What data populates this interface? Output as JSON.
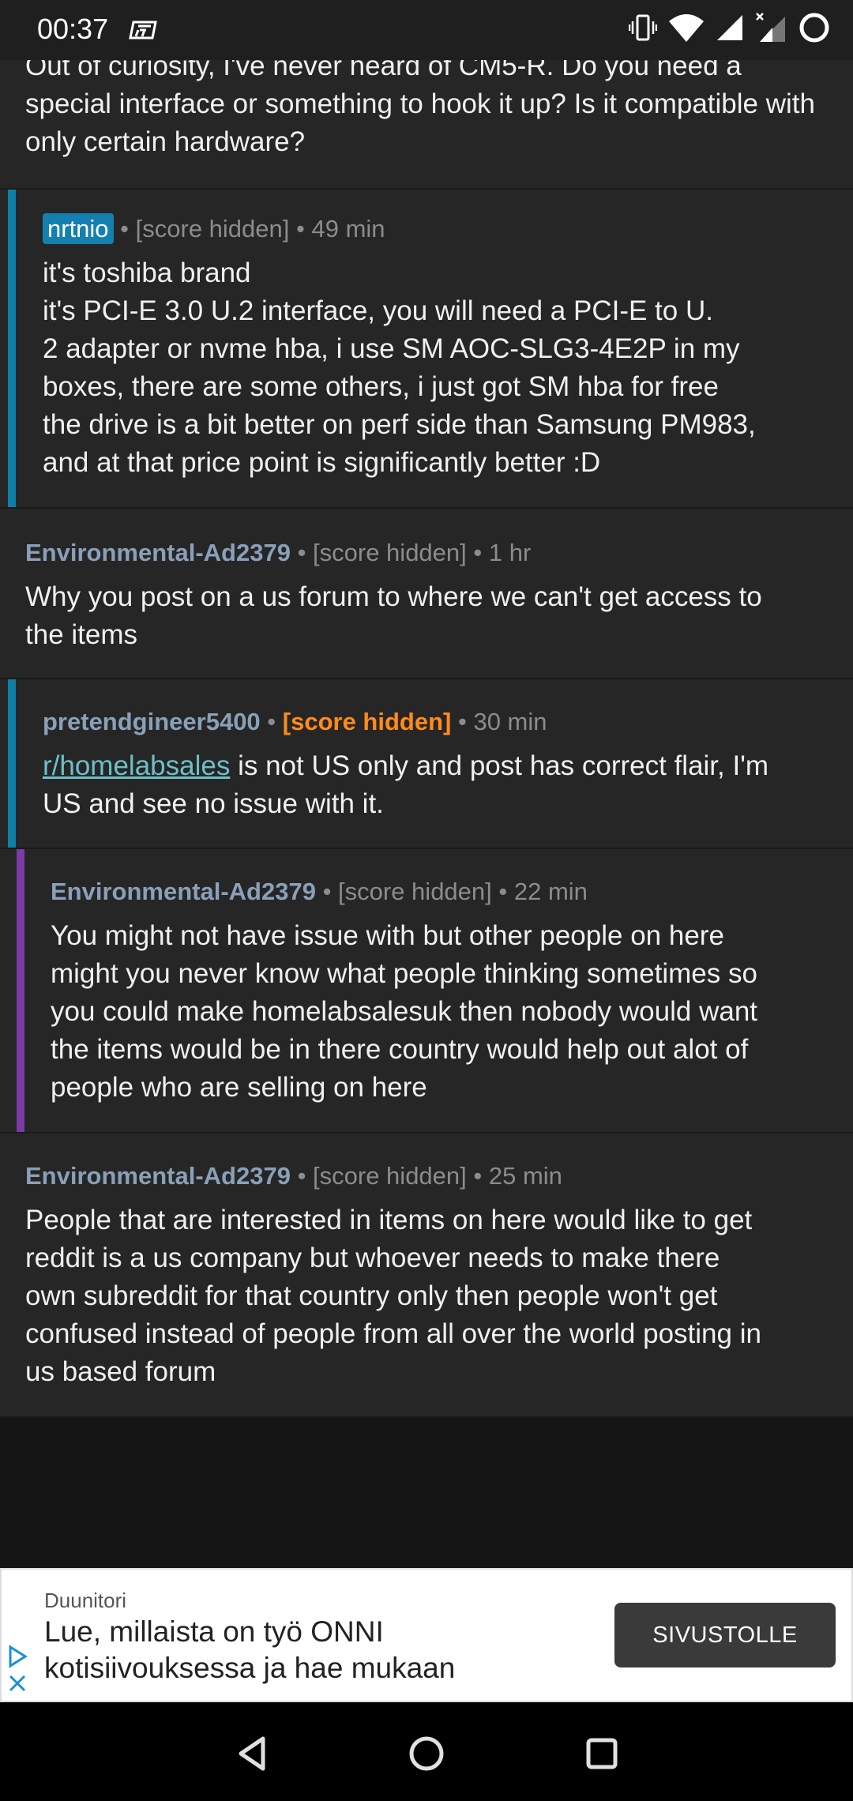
{
  "status_bar": {
    "time": "00:37"
  },
  "comments": [
    {
      "id": "c0",
      "body": "Out of curiosity, I've never heard of CM5-R. Do you need a special interface or something to hook it up? Is it compatible with only certain hardware?"
    },
    {
      "id": "c1",
      "author": "nrtnio",
      "score": "[score hidden]",
      "time": "49 min",
      "body_lines": [
        "it's toshiba brand",
        "it's PCI-E 3.0 U.2 interface, you will need a PCI-E to U.",
        "2 adapter or nvme hba, i use SM AOC-SLG3-4E2P in my",
        "boxes, there are some others, i just got SM hba for free",
        "the drive is a bit better on perf side than Samsung PM983,",
        "and at that price point is significantly better :D"
      ]
    },
    {
      "id": "c2",
      "author": "Environmental-Ad2379",
      "score": "[score hidden]",
      "time": "1 hr",
      "body_lines": [
        "Why you post on a us forum to where we can't get access to",
        "the items"
      ]
    },
    {
      "id": "c3",
      "author": "pretendgineer5400",
      "score": "[score hidden]",
      "time": "30 min",
      "link_text": "r/homelabsales",
      "body_line1_rest": " is not US only and post has correct flair, I'm",
      "body_line2": "US and see no issue with it."
    },
    {
      "id": "c4",
      "author": "Environmental-Ad2379",
      "score": "[score hidden]",
      "time": "22 min",
      "body_lines": [
        "You might not have issue with but other people on here",
        "might you never know what people thinking sometimes so",
        "you could make homelabsalesuk then nobody would want",
        "the items would be in there country would help out alot of",
        "people who are selling on here"
      ]
    },
    {
      "id": "c5",
      "author": "Environmental-Ad2379",
      "score": "[score hidden]",
      "time": "25 min",
      "body_lines": [
        "People that are interested in items on here would like to get",
        "reddit is a us company but whoever needs to make there",
        "own subreddit for that country only then people won't get",
        "confused instead of people from all over the world posting in",
        "us based forum"
      ]
    }
  ],
  "ad": {
    "advertiser": "Duunitori",
    "headline_line1": "Lue, millaista on työ ONNI",
    "headline_line2": "kotisiivouksessa ja hae mukaan",
    "cta": "SIVUSTOLLE"
  },
  "colors": {
    "bar_blue": "#0e7fa6",
    "bar_purple": "#7b3aa8",
    "flair_bg": "#1480b0",
    "score_orange": "#ff8c1a",
    "link": "#6cc0c8"
  },
  "icons": {
    "status_right": [
      "vibrate-icon",
      "wifi-icon",
      "cell-signal-icon",
      "cell-signal-noservice-icon",
      "battery-ring-icon"
    ],
    "nav": [
      "back-icon",
      "home-icon",
      "recents-icon"
    ]
  }
}
